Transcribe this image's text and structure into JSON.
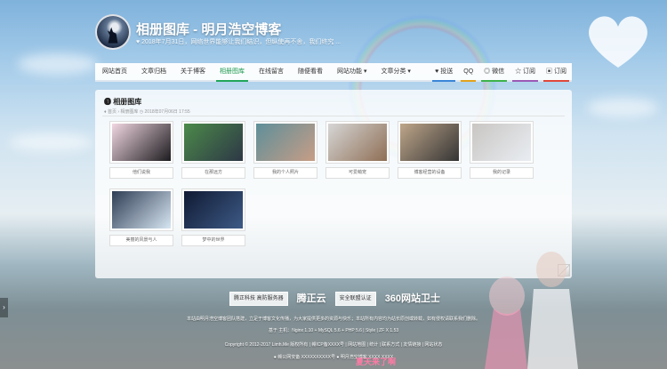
{
  "header": {
    "title": "相册图库 - 明月浩空博客",
    "description": "♥ 2018年7月31日，网络世界能够让我们结识，但纵使再不舍，我们终究 ..."
  },
  "nav": {
    "items": [
      {
        "label": "网站首页",
        "active": false
      },
      {
        "label": "文章归档",
        "active": false
      },
      {
        "label": "关于博客",
        "active": false
      },
      {
        "label": "相册图库",
        "active": true
      },
      {
        "label": "在线留言",
        "active": false
      },
      {
        "label": "随便看看",
        "active": false
      },
      {
        "label": "网站功能 ▾",
        "active": false
      },
      {
        "label": "文章分类 ▾",
        "active": false
      }
    ],
    "right": [
      {
        "label": "♥ 投送",
        "icon": "heart-icon"
      },
      {
        "label": "QQ",
        "icon": "qq-icon"
      },
      {
        "label": "◎ 微信",
        "icon": "wechat-icon"
      },
      {
        "label": "☆ 订阅",
        "icon": "rss-icon"
      },
      {
        "label": "▣ 订阅",
        "icon": "mail-icon"
      }
    ]
  },
  "panel": {
    "title": "❶ 相册图库",
    "meta": "♦ 首页 › 相册图库 ◷ 2018年07月06日 17:55"
  },
  "albums": [
    {
      "caption": "他们说我",
      "colors": [
        "#f2d7e2",
        "#1c1c1f"
      ]
    },
    {
      "caption": "在那远方",
      "colors": [
        "#4c8a4a",
        "#2d3746"
      ]
    },
    {
      "caption": "我的个人照片",
      "colors": [
        "#5e8f9a",
        "#c79d86"
      ]
    },
    {
      "caption": "可爱萌宠",
      "colors": [
        "#d6d6d6",
        "#8f6f55"
      ]
    },
    {
      "caption": "博客经营的设备",
      "colors": [
        "#bfa68a",
        "#343434"
      ]
    },
    {
      "caption": "我的记录",
      "colors": [
        "#c9c6c3",
        "#e9edf2"
      ]
    },
    {
      "caption": "美丽的风景与人",
      "colors": [
        "#2f3d55",
        "#d7e6f2"
      ]
    },
    {
      "caption": "梦中的世界",
      "colors": [
        "#101a33",
        "#3d5a86"
      ]
    }
  ],
  "footer": {
    "badges": [
      "腾正科技 高防服务器",
      "腾正云",
      "安全联盟认证",
      "360网站卫士"
    ],
    "line1": "本站由明月浩空博客团队搭建，立足于博客文化传播，为大家提供更多的资源与快乐；本站所有内容均为站长原创或转载，如有侵权请联系我们删除。",
    "line2": "基于 主机：Nginx 1.10 + MySQL 5.6 + PHP 5.6 | Style | ZF X 1.53",
    "line3": "Copyright © 2012-2017 Limh.Me 版权所有 | 赣ICP备XXXX号 | 网站地图 | 统计 | 联系方式 | 友情链接 | 网站状态",
    "line4": "● 赣公网安备 XXXXXXXXXX号  ● 明月浩空博客 XXXX XXXX",
    "watermark": "夏天来了啊"
  },
  "ui": {
    "side_handle": "›"
  }
}
